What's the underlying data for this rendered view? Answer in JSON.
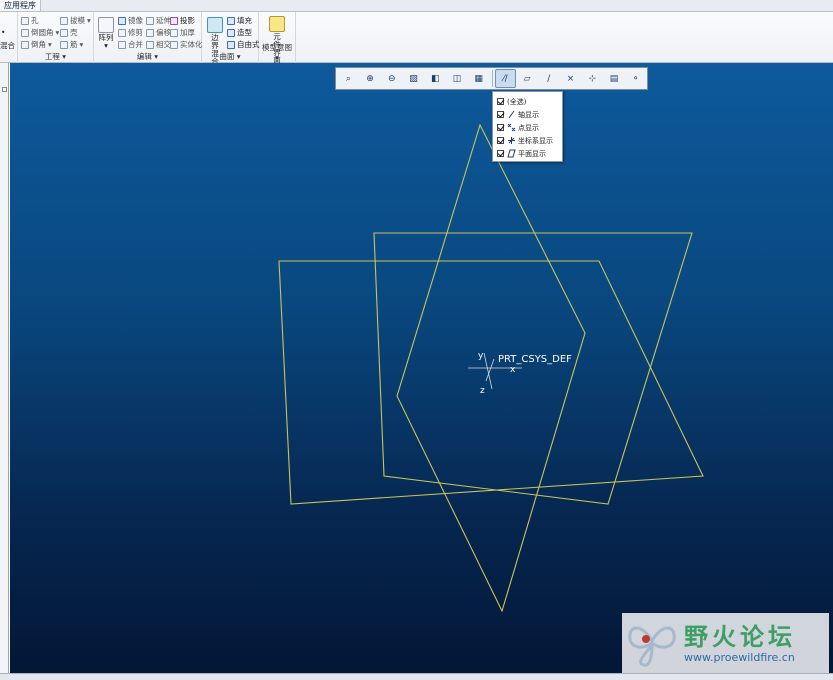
{
  "tab": {
    "label": "应用程序"
  },
  "ribbon": {
    "engineering": {
      "label": "工程",
      "items": [
        "孔",
        "倒圆角",
        "倒角",
        "拔模",
        "壳",
        "筋"
      ],
      "left_labels": [
        "•",
        "混合"
      ]
    },
    "editing": {
      "label": "编辑",
      "array": "阵列",
      "items": [
        "镜像",
        "修剪",
        "合并",
        "延伸",
        "偏移",
        "相交",
        "投影",
        "加厚",
        "实体化"
      ]
    },
    "surface": {
      "label": "曲面",
      "boundary": "边界混合",
      "items": [
        "填充",
        "造型",
        "自由式"
      ]
    },
    "model_intent": {
      "label": "模型意图",
      "component_ui": "元件界面"
    }
  },
  "graphics_toolbar": {
    "buttons": [
      "zoom-fit",
      "zoom-in",
      "zoom-out",
      "repaint",
      "view-orientation",
      "saved-views",
      "display-style",
      "datum-display",
      "plane-display",
      "axis-display",
      "point-display",
      "csys-display",
      "spin-center",
      "annotation-display"
    ]
  },
  "datum_dropdown": {
    "items": [
      {
        "label": "(全选)",
        "checked": true
      },
      {
        "label": "轴显示",
        "checked": true
      },
      {
        "label": "点显示",
        "checked": true
      },
      {
        "label": "坐标系显示",
        "checked": true
      },
      {
        "label": "平面显示",
        "checked": true
      }
    ]
  },
  "viewport": {
    "csys_label": "PRT_CSYS_DEF",
    "axis_x": "x",
    "axis_y": "y",
    "axis_z": "z",
    "line_color": "#c8c45a"
  },
  "watermark": {
    "title": "野火论坛",
    "url": "www.proewildfire.cn"
  }
}
